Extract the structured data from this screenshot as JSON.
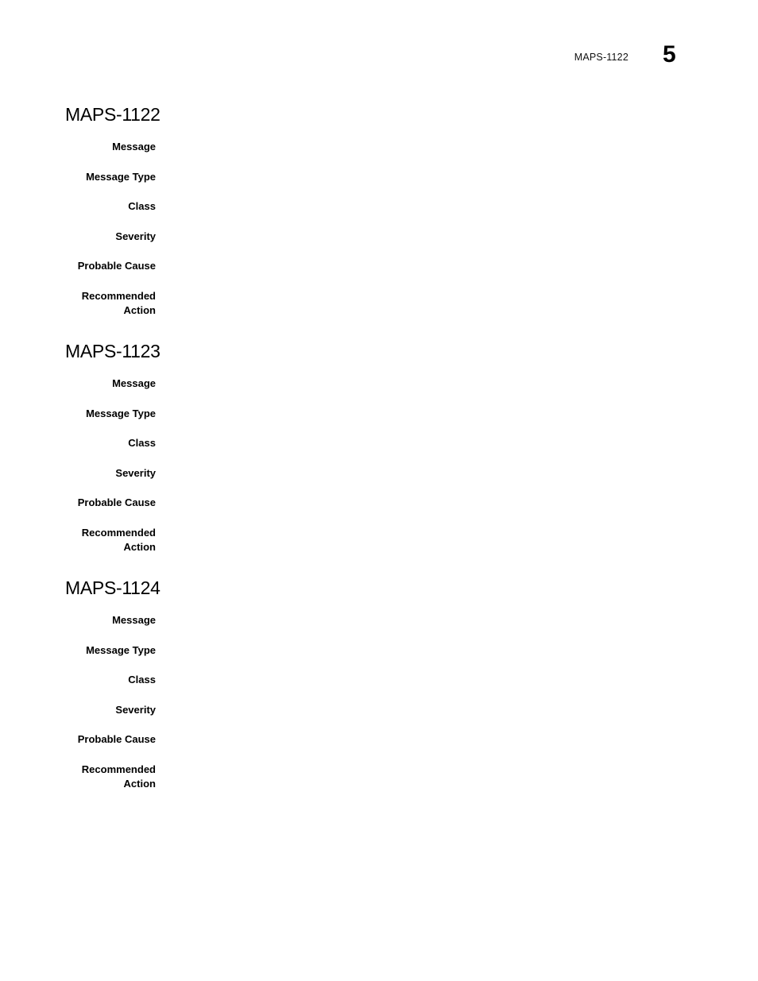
{
  "page": {
    "header": {
      "chapter_title": "MAPS-1122",
      "page_number": "5"
    },
    "sections": [
      {
        "heading": "MAPS-1122",
        "fields": [
          {
            "label": "Message",
            "value": ""
          },
          {
            "label": "Message Type",
            "value": ""
          },
          {
            "label": "Class",
            "value": ""
          },
          {
            "label": "Severity",
            "value": ""
          },
          {
            "label": "Probable Cause",
            "value": ""
          },
          {
            "label": "Recommended\nAction",
            "value": ""
          }
        ]
      },
      {
        "heading": "MAPS-1123",
        "fields": [
          {
            "label": "Message",
            "value": ""
          },
          {
            "label": "Message Type",
            "value": ""
          },
          {
            "label": "Class",
            "value": ""
          },
          {
            "label": "Severity",
            "value": ""
          },
          {
            "label": "Probable Cause",
            "value": ""
          },
          {
            "label": "Recommended\nAction",
            "value": ""
          }
        ]
      },
      {
        "heading": "MAPS-1124",
        "fields": [
          {
            "label": "Message",
            "value": ""
          },
          {
            "label": "Message Type",
            "value": ""
          },
          {
            "label": "Class",
            "value": ""
          },
          {
            "label": "Severity",
            "value": ""
          },
          {
            "label": "Probable Cause",
            "value": ""
          },
          {
            "label": "Recommended\nAction",
            "value": ""
          }
        ]
      }
    ]
  }
}
